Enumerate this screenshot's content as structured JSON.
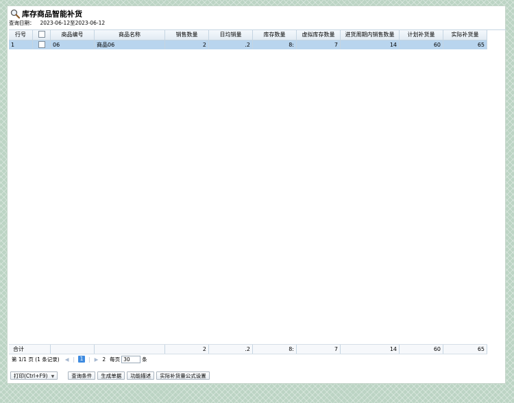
{
  "title": "库存商品智能补货",
  "query_date": {
    "label": "查询日期：",
    "value": "2023-06-12至2023-06-12"
  },
  "columns": [
    "行号",
    "",
    "商品编号",
    "商品名称",
    "销售数量",
    "日均销量",
    "库存数量",
    "虚拟库存数量",
    "进货周期内销售数量",
    "计划补货量",
    "实际补货量"
  ],
  "rows": [
    {
      "no": "1",
      "code": "06",
      "name": "商品06",
      "sales": "2",
      "daily": ".2",
      "stock": "8:",
      "virtual": "7",
      "cycle": "14",
      "plan": "60",
      "actual": "65"
    }
  ],
  "footer": {
    "label": "合计",
    "sales": "2",
    "daily": ".2",
    "stock": "8:",
    "virtual": "7",
    "cycle": "14",
    "plan": "60",
    "actual": "65"
  },
  "pager": {
    "info": "第 1/1 页 (1 条记录)",
    "current_page": "1",
    "next_page": "2",
    "per_page_label": "每页",
    "per_page": "30",
    "unit": "条"
  },
  "toolbar": {
    "print": "打印(Ctrl+F9)",
    "query": "查询条件",
    "generate": "生成单据",
    "describe": "功能描述",
    "formula": "实际补货量公式设置"
  }
}
